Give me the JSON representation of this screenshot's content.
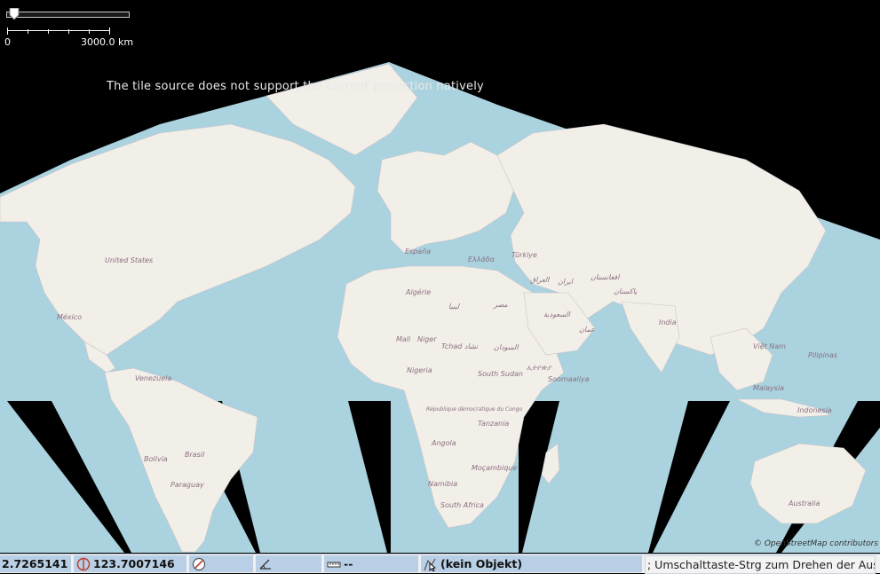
{
  "map": {
    "warning_text": "The tile source does not support the current projection natively",
    "attribution": "© OpenStreetMap contributors",
    "colors": {
      "ocean": "#aad3df",
      "land": "#f2efe9",
      "background": "#000000"
    },
    "labels": [
      {
        "text": "United States",
        "cls": "country"
      },
      {
        "text": "México",
        "cls": "country"
      },
      {
        "text": "Venezuela",
        "cls": "country"
      },
      {
        "text": "Bolivia",
        "cls": "country"
      },
      {
        "text": "Brasil",
        "cls": "country"
      },
      {
        "text": "Paraguay",
        "cls": "country"
      },
      {
        "text": "España",
        "cls": "country"
      },
      {
        "text": "Algérie",
        "cls": "country"
      },
      {
        "text": "ليبيا",
        "cls": "country"
      },
      {
        "text": "مصر",
        "cls": "country"
      },
      {
        "text": "Niger",
        "cls": "country"
      },
      {
        "text": "Mali",
        "cls": "country"
      },
      {
        "text": "Tchad تشاد",
        "cls": "country"
      },
      {
        "text": "السودان",
        "cls": "country"
      },
      {
        "text": "Nigeria",
        "cls": "country"
      },
      {
        "text": "South Sudan",
        "cls": "country"
      },
      {
        "text": "ኢትዮጵያ",
        "cls": "country"
      },
      {
        "text": "Soomaaliya",
        "cls": "country"
      },
      {
        "text": "République démocratique du Congo",
        "cls": "country"
      },
      {
        "text": "Tanzania",
        "cls": "country"
      },
      {
        "text": "Angola",
        "cls": "country"
      },
      {
        "text": "Namibia",
        "cls": "country"
      },
      {
        "text": "Moçambique",
        "cls": "country"
      },
      {
        "text": "South Africa",
        "cls": "country"
      },
      {
        "text": "Türkiye",
        "cls": "country"
      },
      {
        "text": "Ελλάδα",
        "cls": "country"
      },
      {
        "text": "ایران",
        "cls": "country"
      },
      {
        "text": "العراق",
        "cls": "country"
      },
      {
        "text": "السعودية",
        "cls": "country"
      },
      {
        "text": "عمان",
        "cls": "country"
      },
      {
        "text": "افغانستان",
        "cls": "country"
      },
      {
        "text": "پاکستان",
        "cls": "country"
      },
      {
        "text": "India",
        "cls": "country"
      },
      {
        "text": "Việt Nam",
        "cls": "country"
      },
      {
        "text": "Pilipinas",
        "cls": "country"
      },
      {
        "text": "Malaysia",
        "cls": "country"
      },
      {
        "text": "Indonesia",
        "cls": "country"
      },
      {
        "text": "Australia",
        "cls": "country"
      }
    ]
  },
  "zoom": {
    "level_fraction": 0.02
  },
  "scale": {
    "zero_label": "0",
    "max_label": "3000.0 km"
  },
  "status": {
    "latitude": "2.7265141",
    "longitude": "123.7007146",
    "heading": "",
    "angle": "",
    "distance": "--",
    "object": "(kein Objekt)",
    "help": "; Umschalttaste-Strg zum Drehen der Ausw"
  }
}
